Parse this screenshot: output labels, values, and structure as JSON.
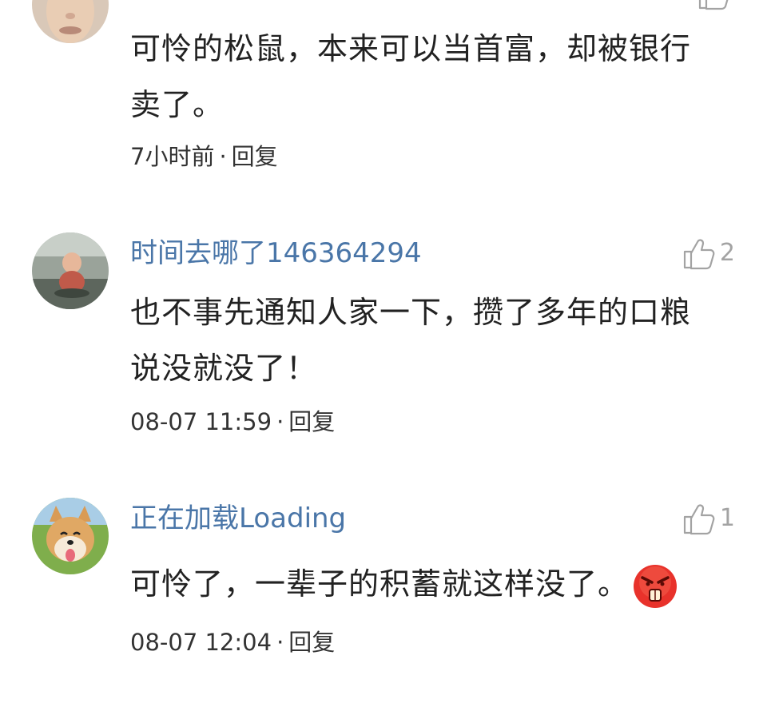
{
  "comments": [
    {
      "username": "",
      "likes": "",
      "text": "可怜的松鼠，本来可以当首富，却被银行卖了。",
      "time": "7小时前",
      "reply_label": "回复",
      "avatar": "person-face-avatar"
    },
    {
      "username": "时间去哪了146364294",
      "likes": "2",
      "text": "也不事先通知人家一下，攒了多年的口粮说没就没了！",
      "time": "08-07 11:59",
      "reply_label": "回复",
      "avatar": "dashboard-figurine-avatar"
    },
    {
      "username": "正在加载Loading",
      "likes": "1",
      "text": "可怜了，一辈子的积蓄就这样没了。",
      "time": "08-07 12:04",
      "reply_label": "回复",
      "avatar": "shiba-dog-avatar",
      "emoji": "angry-face-emoji"
    }
  ],
  "separator": "·",
  "colors": {
    "username": "#4a76a8",
    "text": "#222222",
    "meta": "#333333",
    "like": "#a3a3a3",
    "emoji": "#e8322b"
  }
}
